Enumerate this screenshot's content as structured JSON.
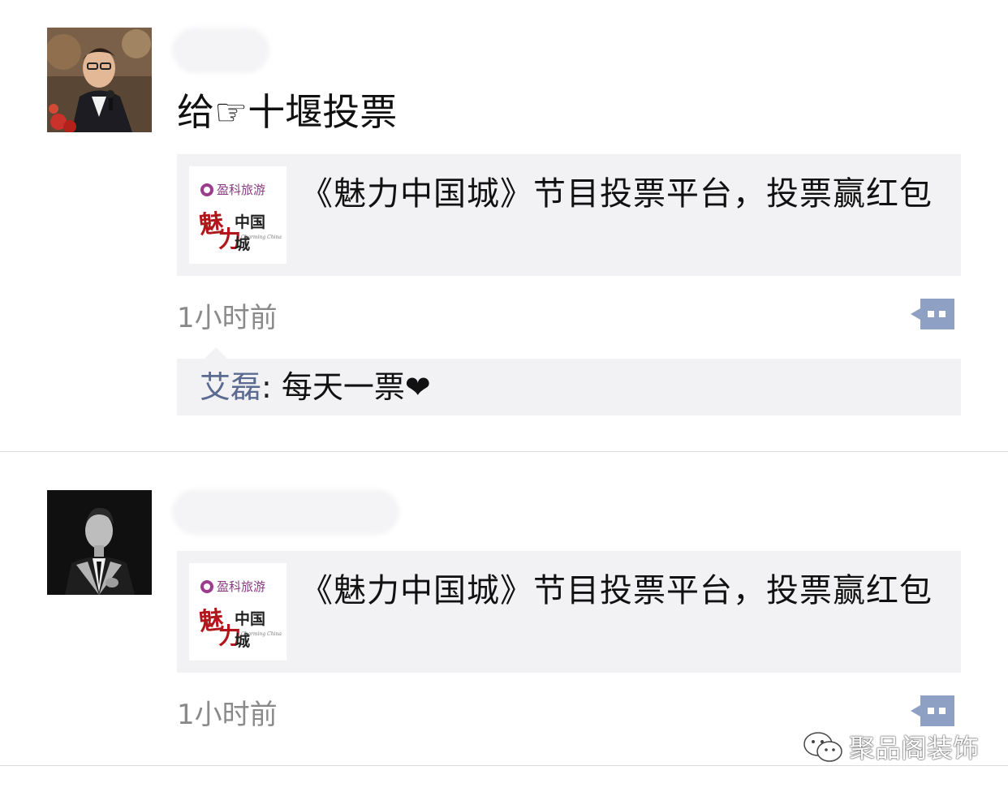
{
  "posts": [
    {
      "avatar": "man-in-suit-with-microphone",
      "text": "给☞十堰投票",
      "link": {
        "thumb_brand": "盈科旅游",
        "thumb_logo_chars": [
          "魅",
          "力",
          "中国城"
        ],
        "thumb_logo_sub": "Charming China",
        "title": "《魅力中国城》节目投票平台，投票赢红包"
      },
      "time": "1小时前",
      "comment_icon": "comment-icon",
      "comments": [
        {
          "author": "艾磊",
          "sep": ": ",
          "text": "每天一票❤"
        }
      ]
    },
    {
      "avatar": "man-in-suit-black-and-white",
      "link": {
        "thumb_brand": "盈科旅游",
        "thumb_logo_chars": [
          "魅",
          "力",
          "中国城"
        ],
        "thumb_logo_sub": "Charming China",
        "title": "《魅力中国城》节目投票平台，投票赢红包"
      },
      "time": "1小时前",
      "comment_icon": "comment-icon"
    }
  ],
  "watermark": {
    "icon": "wechat-icon",
    "label": "聚品阁装饰"
  },
  "colors": {
    "link_name": "#5b6a91",
    "card_bg": "#f2f2f4",
    "time": "#8a8a8a",
    "comment_icon": "#8ea0c4"
  }
}
